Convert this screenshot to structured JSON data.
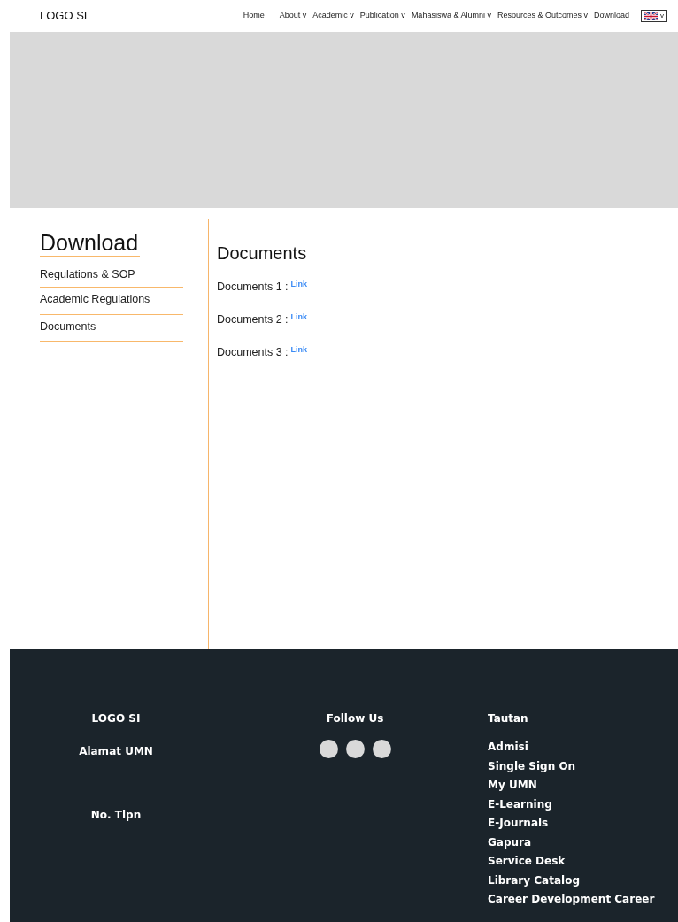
{
  "header": {
    "logo": "LOGO SI",
    "nav": [
      {
        "label": "Home"
      },
      {
        "label": "About",
        "caret": "v"
      },
      {
        "label": "Academic",
        "caret": "v"
      },
      {
        "label": "Publication",
        "caret": "v"
      },
      {
        "label": "Mahasiswa & Alumni",
        "caret": "v"
      },
      {
        "label": "Resources & Outcomes",
        "caret": "v"
      },
      {
        "label": "Download"
      }
    ],
    "language": {
      "caret": "v"
    }
  },
  "banner": {
    "kind": "placeholder"
  },
  "sidebar": {
    "title": "Download",
    "items": [
      "Regulations & SOP",
      "Academic Regulations",
      "Documents"
    ]
  },
  "content": {
    "title": "Documents",
    "documents": [
      {
        "label": "Documents 1 :",
        "link": "Link"
      },
      {
        "label": "Documents 2 :",
        "link": "Link"
      },
      {
        "label": "Documents 3 :",
        "link": "Link"
      }
    ]
  },
  "footer": {
    "logo": "LOGO SI",
    "address": "Alamat UMN",
    "phone": "No. Tlpn",
    "follow_title": "Follow Us",
    "social": [
      {
        "kind": "circle"
      },
      {
        "kind": "circle"
      },
      {
        "kind": "circle"
      }
    ],
    "links_title": "Tautan",
    "links": [
      "Admisi",
      "Single Sign On",
      "My UMN",
      "E-Learning",
      "E-Journals",
      "Gapura",
      "Service Desk",
      "Library Catalog",
      "Career Development Career"
    ]
  }
}
